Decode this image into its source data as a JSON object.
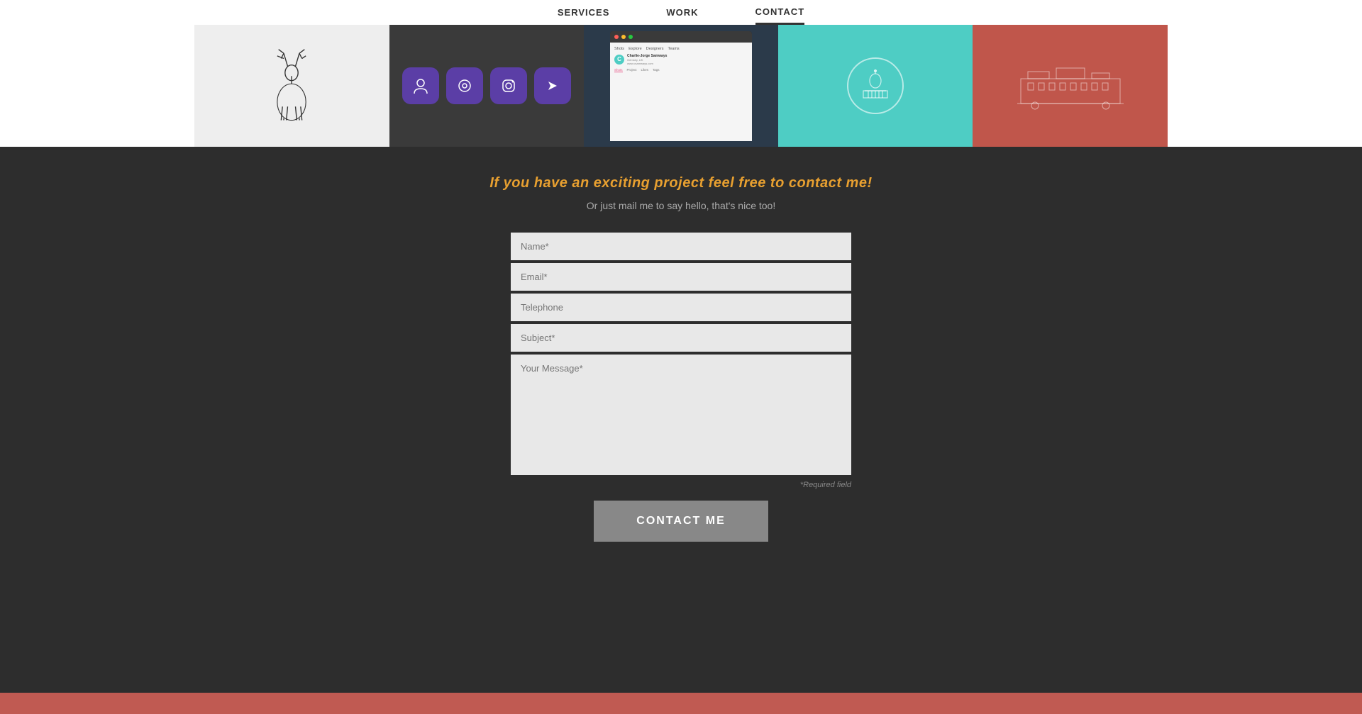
{
  "nav": {
    "items": [
      {
        "label": "SERVICES",
        "active": false
      },
      {
        "label": "WORK",
        "active": false
      },
      {
        "label": "CONTACT",
        "active": true
      }
    ]
  },
  "gallery": {
    "items": [
      {
        "type": "white-left"
      },
      {
        "type": "white-deer"
      },
      {
        "type": "dark-apps"
      },
      {
        "type": "dribbble"
      },
      {
        "type": "teal"
      },
      {
        "type": "coral"
      },
      {
        "type": "white-right"
      }
    ]
  },
  "main": {
    "tagline": "If you have an exciting project feel free to contact me!",
    "sub_tagline": "Or just mail me to say hello, that's nice too!",
    "form": {
      "name_placeholder": "Name*",
      "email_placeholder": "Email*",
      "telephone_placeholder": "Telephone",
      "subject_placeholder": "Subject*",
      "message_placeholder": "Your Message*",
      "required_note": "*Required field",
      "submit_label": "CONTACT ME"
    }
  },
  "dribbble": {
    "user_initial": "C",
    "user_name": "Charlie-Jorge Samways",
    "user_location": "Grimsby, UK",
    "user_website": "www.csamways.com",
    "tabs": [
      "Shots",
      "Project",
      "Likes",
      "Tags"
    ],
    "active_tab": "Shots"
  }
}
